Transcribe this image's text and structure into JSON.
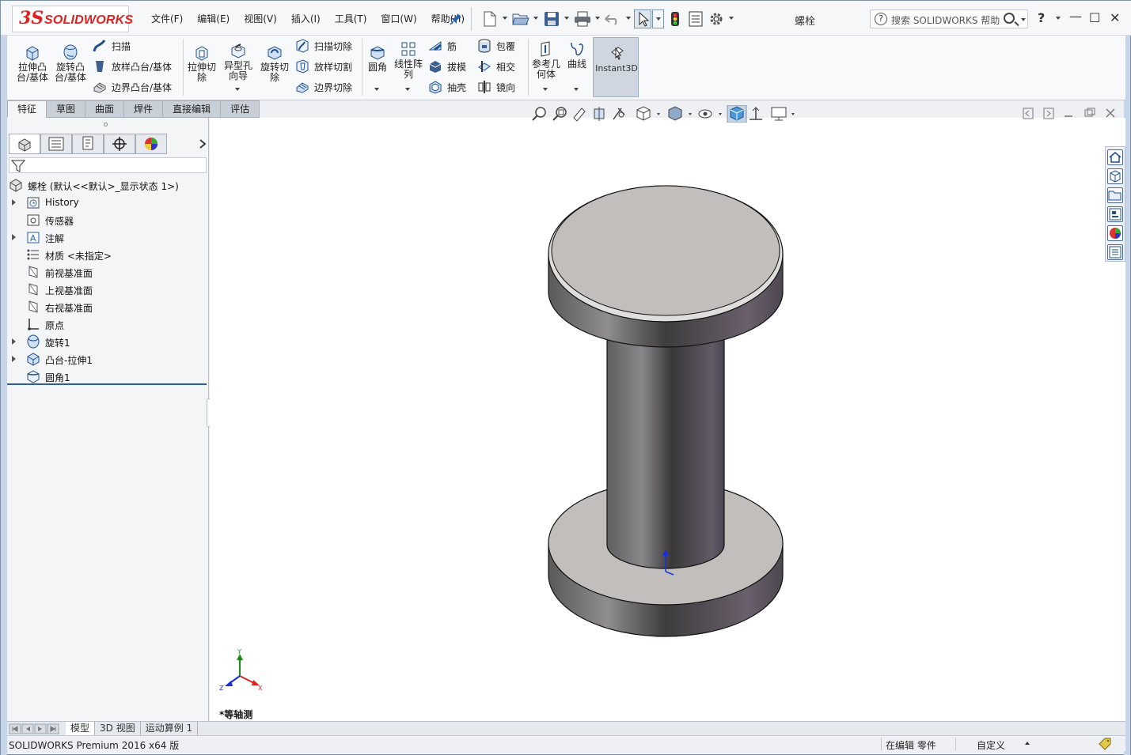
{
  "app": {
    "title": "螺栓",
    "logo_ds": "3S",
    "logo_text": "SOLIDWORKS"
  },
  "menu": [
    "文件(F)",
    "编辑(E)",
    "视图(V)",
    "插入(I)",
    "工具(T)",
    "窗口(W)",
    "帮助(H)"
  ],
  "search": {
    "placeholder": "搜索 SOLIDWORKS 帮助",
    "help_glyph": "?"
  },
  "window_controls": {
    "help": "?",
    "minimize": "—",
    "maximize": "☐",
    "close": "✕"
  },
  "ribbon": {
    "extrude_boss": "拉伸凸\n台/基体",
    "revolve_boss": "旋转凸\n台/基体",
    "sweep": "扫描",
    "loft": "放样凸台/基体",
    "boundary": "边界凸台/基体",
    "extrude_cut": "拉伸切\n除",
    "hole_wizard": "异型孔\n向导",
    "revolve_cut": "旋转切\n除",
    "sweep_cut": "扫描切除",
    "loft_cut": "放样切割",
    "boundary_cut": "边界切除",
    "fillet": "圆角",
    "linear_pattern": "线性阵\n列",
    "rib": "筋",
    "draft": "拔模",
    "shell": "抽壳",
    "wrap": "包覆",
    "intersect": "相交",
    "mirror": "镜向",
    "ref_geometry": "参考几\n何体",
    "curves": "曲线",
    "instant3d": "Instant3D"
  },
  "command_tabs": [
    "特征",
    "草图",
    "曲面",
    "焊件",
    "直接编辑",
    "评估"
  ],
  "tree": {
    "root": "螺栓 (默认<<默认>_显示状态 1>)",
    "items": [
      {
        "label": "History",
        "expandable": true,
        "icon": "history-icon"
      },
      {
        "label": "传感器",
        "expandable": false,
        "icon": "sensor-icon"
      },
      {
        "label": "注解",
        "expandable": true,
        "icon": "annotation-icon"
      },
      {
        "label": "材质 <未指定>",
        "expandable": false,
        "icon": "material-icon"
      },
      {
        "label": "前视基准面",
        "expandable": false,
        "icon": "plane-icon"
      },
      {
        "label": "上视基准面",
        "expandable": false,
        "icon": "plane-icon"
      },
      {
        "label": "右视基准面",
        "expandable": false,
        "icon": "plane-icon"
      },
      {
        "label": "原点",
        "expandable": false,
        "icon": "origin-icon"
      },
      {
        "label": "旋转1",
        "expandable": true,
        "icon": "revolve-feature-icon"
      },
      {
        "label": "凸台-拉伸1",
        "expandable": true,
        "icon": "extrude-feature-icon"
      },
      {
        "label": "圆角1",
        "expandable": false,
        "icon": "fillet-feature-icon"
      }
    ]
  },
  "viewport": {
    "view_label": "*等轴测",
    "triad": {
      "x": "X",
      "y": "Y",
      "z": "Z"
    }
  },
  "bottom_tabs": [
    "模型",
    "3D 视图",
    "运动算例 1"
  ],
  "status": {
    "left": "SOLIDWORKS Premium 2016 x64 版",
    "mode": "在编辑 零件",
    "units": "自定义"
  },
  "colors": {
    "accent": "#2c5fa0",
    "model_face": "#c2bebb",
    "model_side_dark": "#3a3839",
    "model_side_light": "#8f8c8d"
  }
}
